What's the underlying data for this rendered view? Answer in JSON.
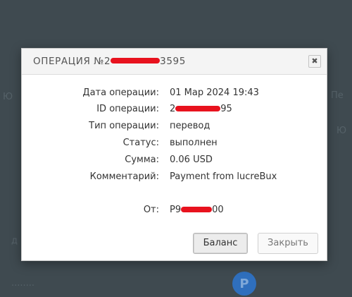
{
  "background": {
    "avatar_letter": "P",
    "text_bottom_left": "........",
    "text_mid_left": "д",
    "text_right_1": "Пе",
    "text_right_2": "Ю"
  },
  "dialog": {
    "title_prefix": "ОПЕРАЦИЯ №2",
    "title_suffix": "3595",
    "close_glyph": "✖",
    "fields": {
      "date_label": "Дата операции:",
      "date_value": "01 Мар 2024 19:43",
      "id_label": "ID операции:",
      "id_value_prefix": "2",
      "id_value_suffix": "95",
      "type_label": "Тип операции:",
      "type_value": "перевод",
      "status_label": "Статус:",
      "status_value": "выполнен",
      "sum_label": "Сумма:",
      "sum_value": "0.06 USD",
      "comment_label": "Комментарий:",
      "comment_value": "Payment from lucreBux",
      "from_label": "От:",
      "from_value_prefix": "P9",
      "from_value_suffix": "00"
    },
    "buttons": {
      "balance": "Баланс",
      "close": "Закрыть"
    }
  },
  "colors": {
    "overlay": "#3f4a50",
    "redaction": "#e8121e"
  }
}
